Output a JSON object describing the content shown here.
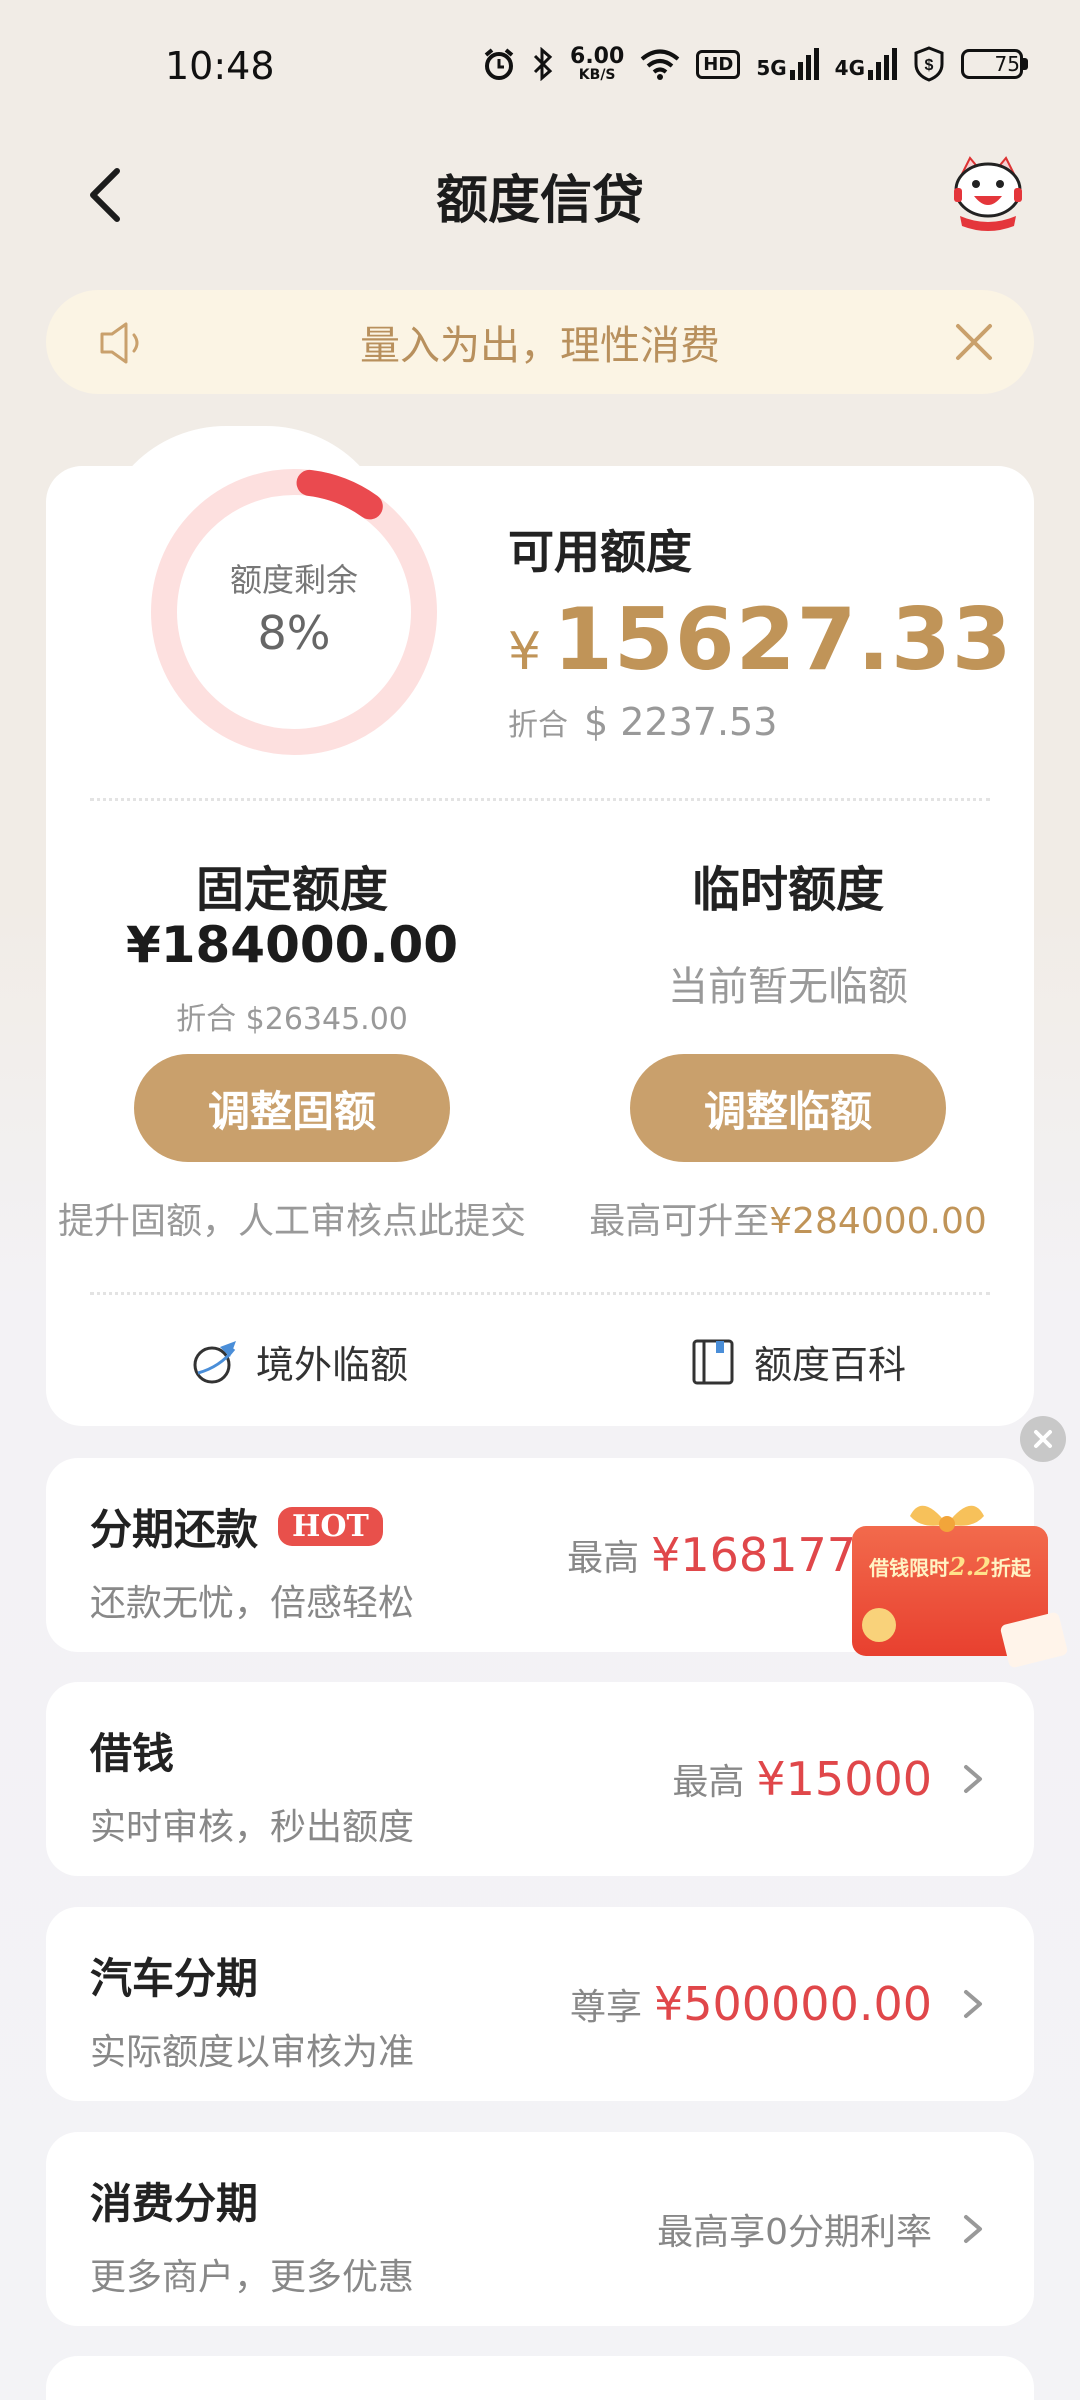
{
  "status_bar": {
    "time": "10:48",
    "net_speed": "6.00",
    "net_unit": "KB/S",
    "hd_label": "HD",
    "sig1_label": "5G",
    "sig2_label": "4G",
    "battery": "75",
    "battery_level": 0.75
  },
  "header": {
    "title": "额度信贷"
  },
  "notice": {
    "text": "量入为出，理性消费"
  },
  "credit": {
    "ring_label": "额度剩余",
    "ring_value": "8%",
    "ring_fraction": 0.08,
    "available_title": "可用额度",
    "currency_symbol": "¥",
    "available_amount": "15627.33",
    "usd_label": "折合",
    "usd_amount": "$ 2237.53",
    "fixed_title": "固定额度",
    "fixed_amount": "¥184000.00",
    "fixed_usd": "折合 $26345.00",
    "temp_title": "临时额度",
    "temp_none": "当前暂无临额",
    "btn_fixed": "调整固额",
    "btn_temp": "调整临额",
    "fixed_hint": "提升固额，人工审核点此提交",
    "temp_hint_prefix": "最高可升至",
    "temp_hint_amount": "¥284000.00",
    "link_overseas": "境外临额",
    "link_wiki": "额度百科"
  },
  "list": [
    {
      "title": "分期还款",
      "badge": "HOT",
      "subtitle": "还款无忧，倍感轻松",
      "prefix": "最高",
      "amount": "¥168177"
    },
    {
      "title": "借钱",
      "subtitle": "实时审核，秒出额度",
      "prefix": "最高",
      "amount": "¥15000"
    },
    {
      "title": "汽车分期",
      "subtitle": "实际额度以审核为准",
      "prefix": "尊享",
      "amount": "¥500000.00"
    },
    {
      "title": "消费分期",
      "subtitle": "更多商户，更多优惠",
      "plain": "最高享0分期利率"
    }
  ],
  "promo": {
    "text_prefix": "借钱限时",
    "text_discount": "2.2",
    "text_suffix": "折起"
  },
  "colors": {
    "gold": "#c09458",
    "button_gold": "#c9a06c",
    "red": "#e0474a",
    "ring_track": "#fde0df",
    "ring_fill": "#ea4a4f"
  }
}
